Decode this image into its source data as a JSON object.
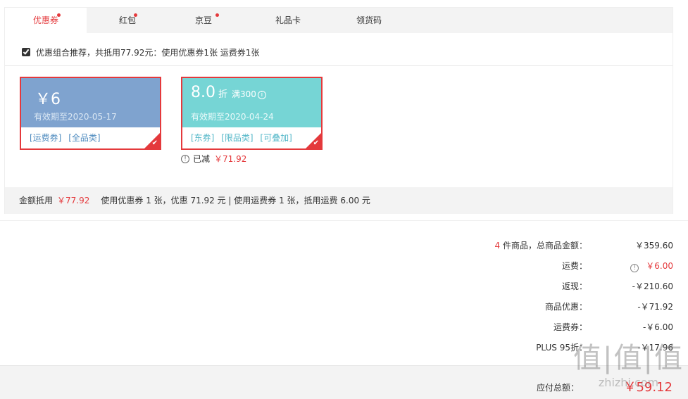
{
  "tabs": [
    {
      "label": "优惠券",
      "active": true,
      "dot": true
    },
    {
      "label": "红包",
      "active": false,
      "dot": true
    },
    {
      "label": "京豆",
      "active": false,
      "dot": true
    },
    {
      "label": "礼品卡",
      "active": false,
      "dot": false
    },
    {
      "label": "领货码",
      "active": false,
      "dot": false
    }
  ],
  "recommend": {
    "checked": true,
    "text": "优惠组合推荐，共抵用77.92元：使用优惠券1张 运费券1张"
  },
  "coupons": [
    {
      "amount": "￥6",
      "expiry": "有效期至2020-05-17",
      "tags": [
        "[运费券]",
        "[全品类]"
      ],
      "color": "#7fa3cf",
      "selected": true
    },
    {
      "amount": "8.0",
      "discount_unit": "折",
      "condition": "满300",
      "expiry": "有效期至2020-04-24",
      "tags": [
        "[东券]",
        "[限品类]",
        "[可叠加]"
      ],
      "color": "#76d5d5",
      "selected": true
    }
  ],
  "reduced": {
    "label": "已减",
    "amount": "￥71.92"
  },
  "summary": {
    "label": "金额抵用",
    "amount": "￥77.92",
    "detail": "使用优惠券 1 张，优惠 71.92 元 | 使用运费券 1 张，抵用运费 6.00 元"
  },
  "totals": {
    "items_count": "4",
    "items_label": " 件商品，总商品金额：",
    "items_value": "￥359.60",
    "shipping_label": "运费：",
    "shipping_value": "￥6.00",
    "cashback_label": "返现：",
    "cashback_value": "-￥210.60",
    "product_discount_label": "商品优惠：",
    "product_discount_value": "-￥71.92",
    "shipping_coupon_label": "运费券：",
    "shipping_coupon_value": "-￥6.00",
    "plus_label": "PLUS 95折：",
    "plus_value": "-￥17.96"
  },
  "payable": {
    "label": "应付总额：",
    "value": "￥59.12"
  },
  "watermark": {
    "glyphs": "值|值|值",
    "text": "zhizhi.com"
  },
  "colors": {
    "accent": "#e4393c",
    "coupon_blue": "#7fa3cf",
    "coupon_teal": "#76d5d5"
  }
}
